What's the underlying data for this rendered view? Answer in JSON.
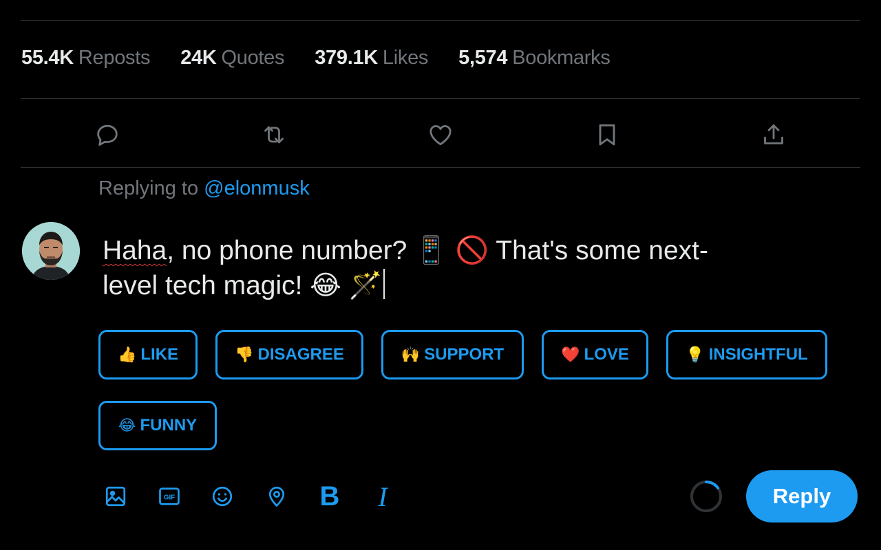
{
  "stats": [
    {
      "value": "55.4K",
      "label": "Reposts"
    },
    {
      "value": "24K",
      "label": "Quotes"
    },
    {
      "value": "379.1K",
      "label": "Likes"
    },
    {
      "value": "5,574",
      "label": "Bookmarks"
    }
  ],
  "actions": [
    "reply-icon",
    "repost-icon",
    "like-icon",
    "bookmark-icon",
    "share-icon"
  ],
  "replying": {
    "prefix": "Replying to",
    "handle": "@elonmusk"
  },
  "composer": {
    "typo_word": "Haha",
    "line1_rest": ", no phone number? 📱 🚫 That's some next-",
    "line2": "level tech magic! 😂 🪄"
  },
  "reactions": [
    {
      "emoji": "👍",
      "label": "LIKE"
    },
    {
      "emoji": "👎",
      "label": "DISAGREE"
    },
    {
      "emoji": "🙌",
      "label": "SUPPORT"
    },
    {
      "emoji": "❤️",
      "label": "LOVE"
    },
    {
      "emoji": "💡",
      "label": "INSIGHTFUL"
    },
    {
      "emoji": "😂",
      "label": "FUNNY"
    }
  ],
  "toolbar": {
    "icons": [
      "image-icon",
      "gif-icon",
      "emoji-icon",
      "location-icon",
      "bold-icon",
      "italic-icon"
    ],
    "gif_label": "GIF",
    "bold_label": "B",
    "italic_label": "I",
    "char_progress": 0.15
  },
  "reply_button": "Reply",
  "colors": {
    "accent": "#1d9bf0",
    "muted": "#71767b",
    "divider": "#2f3336",
    "background": "#000000"
  }
}
